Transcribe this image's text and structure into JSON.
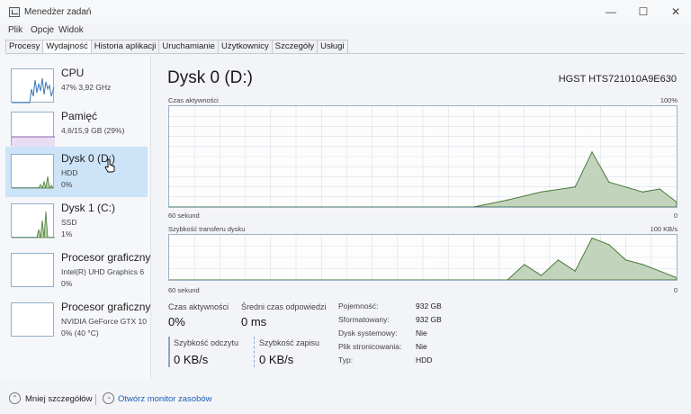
{
  "window": {
    "title": "Menedżer zadań",
    "controls": [
      "—",
      "☐",
      "✕"
    ]
  },
  "menu": [
    "Plik",
    "Opcje",
    "Widok"
  ],
  "tabs": [
    "Procesy",
    "Wydajność",
    "Historia aplikacji",
    "Uruchamianie",
    "Użytkownicy",
    "Szczegóły",
    "Usługi"
  ],
  "active_tab": "Wydajność",
  "sidebar": [
    {
      "name": "CPU",
      "sub1": "47% 3,92 GHz",
      "sub2": ""
    },
    {
      "name": "Pamięć",
      "sub1": "4,6/15,9 GB (29%)",
      "sub2": ""
    },
    {
      "name": "Dysk 0 (D:)",
      "sub1": "HDD",
      "sub2": "0%"
    },
    {
      "name": "Dysk 1 (C:)",
      "sub1": "SSD",
      "sub2": "1%"
    },
    {
      "name": "Procesor graficzny",
      "sub1": "Intel(R) UHD Graphics 6",
      "sub2": "0%"
    },
    {
      "name": "Procesor graficzny",
      "sub1": "NVIDIA GeForce GTX 10",
      "sub2": "0% (40 °C)"
    }
  ],
  "main": {
    "title": "Dysk 0 (D:)",
    "model": "HGST HTS721010A9E630",
    "graph1": {
      "label": "Czas aktywności",
      "max": "100%",
      "time": "60 sekund",
      "min": "0"
    },
    "graph2": {
      "label": "Szybkość transferu dysku",
      "max": "100 KB/s",
      "time": "60 sekund",
      "min": "0"
    },
    "stats": {
      "active_label": "Czas aktywności",
      "active_value": "0%",
      "response_label": "Średni czas odpowiedzi",
      "response_value": "0 ms",
      "read_label": "Szybkość odczytu",
      "read_value": "0 KB/s",
      "write_label": "Szybkość zapisu",
      "write_value": "0 KB/s"
    },
    "properties": [
      {
        "label": "Pojemność:",
        "value": "932 GB"
      },
      {
        "label": "Sformatowany:",
        "value": "932 GB"
      },
      {
        "label": "Dysk systemowy:",
        "value": "Nie"
      },
      {
        "label": "Plik stronicowania:",
        "value": "Nie"
      },
      {
        "label": "Typ:",
        "value": "HDD"
      }
    ]
  },
  "footer": {
    "less_details": "Mniej szczegółów",
    "open_monitor": "Otwórz monitor zasobów"
  },
  "colors": {
    "accent": "#cde3f7",
    "graph_line": "#4a7a3a",
    "grid": "#d6e0e8",
    "link": "#1a5fb4"
  },
  "chart_data": [
    {
      "type": "area",
      "title": "Czas aktywności",
      "x": [
        60,
        56,
        52,
        48,
        44,
        40,
        36,
        32,
        28,
        24,
        20,
        16,
        12,
        10,
        8,
        4,
        2,
        0
      ],
      "values": [
        0,
        0,
        0,
        0,
        0,
        0,
        0,
        0,
        0,
        0,
        7,
        15,
        20,
        55,
        25,
        15,
        18,
        5
      ],
      "ylim": [
        0,
        100
      ]
    },
    {
      "type": "area",
      "title": "Szybkość transferu dysku",
      "x": [
        60,
        52,
        44,
        36,
        28,
        20,
        18,
        16,
        14,
        12,
        10,
        8,
        6,
        4,
        2,
        0
      ],
      "values": [
        0,
        0,
        0,
        0,
        0,
        0,
        35,
        10,
        45,
        20,
        95,
        80,
        45,
        35,
        20,
        5
      ],
      "ylim": [
        0,
        100
      ]
    }
  ]
}
